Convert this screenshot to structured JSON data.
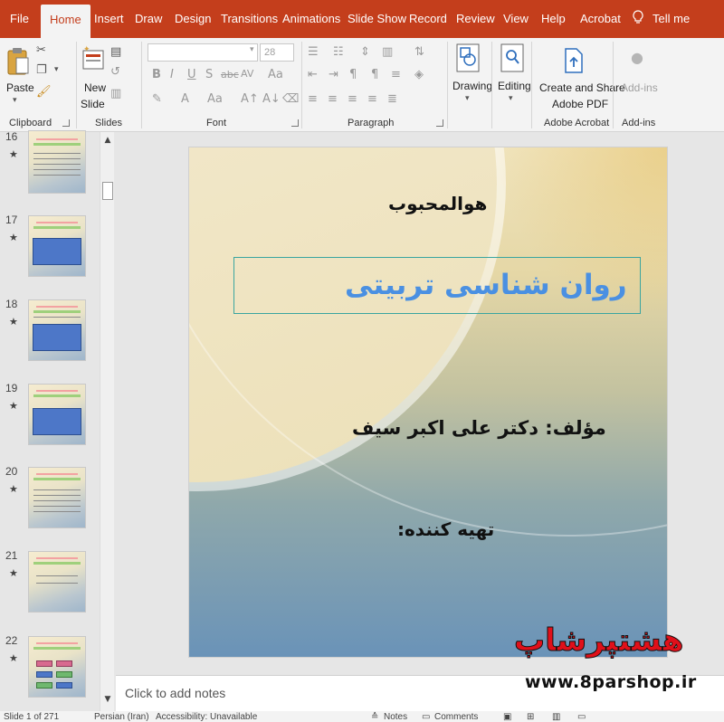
{
  "ribbon": {
    "tabs": [
      "File",
      "Home",
      "Insert",
      "Draw",
      "Design",
      "Transitions",
      "Animations",
      "Slide Show",
      "Record",
      "Review",
      "View",
      "Help",
      "Acrobat"
    ],
    "active_tab": "Home",
    "tell_me": "Tell me",
    "clipboard": {
      "paste": "Paste",
      "label": "Clipboard"
    },
    "slides": {
      "new_slide_1": "New",
      "new_slide_2": "Slide",
      "label": "Slides"
    },
    "font": {
      "size": "28",
      "label": "Font"
    },
    "paragraph": {
      "label": "Paragraph"
    },
    "drawing": {
      "label": "Drawing"
    },
    "editing": {
      "label": "Editing"
    },
    "acrobat": {
      "line1": "Create and Share",
      "line2": "Adobe PDF",
      "label": "Adobe Acrobat"
    },
    "addins": {
      "button": "Add-ins",
      "label": "Add-ins"
    }
  },
  "thumbnails": [
    {
      "num": "16"
    },
    {
      "num": "17"
    },
    {
      "num": "18"
    },
    {
      "num": "19"
    },
    {
      "num": "20"
    },
    {
      "num": "21"
    },
    {
      "num": "22"
    }
  ],
  "slide": {
    "header": "هوالمحبوب",
    "title": "روان شناسی تربیتی",
    "author": "مؤلف: دکتر علی اکبر سیف",
    "compiler": "تهیه کننده:"
  },
  "notes_placeholder": "Click to add notes",
  "status": {
    "slide_count": "Slide 1 of 271",
    "language": "Persian (Iran)",
    "accessibility": "Accessibility: Unavailable",
    "notes": "Notes",
    "comments": "Comments"
  },
  "watermark": {
    "brand": "هشتپرشاپ",
    "url": "www.8parshop.ir"
  },
  "colors": {
    "accent": "#c43e1c",
    "title_blue": "#4a90e2",
    "watermark_red": "#e0101a"
  }
}
